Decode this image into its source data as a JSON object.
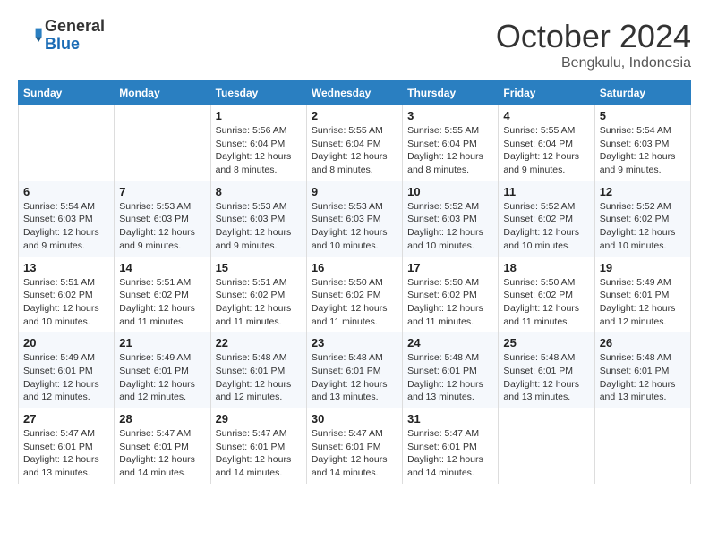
{
  "header": {
    "logo_general": "General",
    "logo_blue": "Blue",
    "month_year": "October 2024",
    "location": "Bengkulu, Indonesia"
  },
  "days_of_week": [
    "Sunday",
    "Monday",
    "Tuesday",
    "Wednesday",
    "Thursday",
    "Friday",
    "Saturday"
  ],
  "weeks": [
    [
      {
        "day": "",
        "sunrise": "",
        "sunset": "",
        "daylight": ""
      },
      {
        "day": "",
        "sunrise": "",
        "sunset": "",
        "daylight": ""
      },
      {
        "day": "1",
        "sunrise": "Sunrise: 5:56 AM",
        "sunset": "Sunset: 6:04 PM",
        "daylight": "Daylight: 12 hours and 8 minutes."
      },
      {
        "day": "2",
        "sunrise": "Sunrise: 5:55 AM",
        "sunset": "Sunset: 6:04 PM",
        "daylight": "Daylight: 12 hours and 8 minutes."
      },
      {
        "day": "3",
        "sunrise": "Sunrise: 5:55 AM",
        "sunset": "Sunset: 6:04 PM",
        "daylight": "Daylight: 12 hours and 8 minutes."
      },
      {
        "day": "4",
        "sunrise": "Sunrise: 5:55 AM",
        "sunset": "Sunset: 6:04 PM",
        "daylight": "Daylight: 12 hours and 9 minutes."
      },
      {
        "day": "5",
        "sunrise": "Sunrise: 5:54 AM",
        "sunset": "Sunset: 6:03 PM",
        "daylight": "Daylight: 12 hours and 9 minutes."
      }
    ],
    [
      {
        "day": "6",
        "sunrise": "Sunrise: 5:54 AM",
        "sunset": "Sunset: 6:03 PM",
        "daylight": "Daylight: 12 hours and 9 minutes."
      },
      {
        "day": "7",
        "sunrise": "Sunrise: 5:53 AM",
        "sunset": "Sunset: 6:03 PM",
        "daylight": "Daylight: 12 hours and 9 minutes."
      },
      {
        "day": "8",
        "sunrise": "Sunrise: 5:53 AM",
        "sunset": "Sunset: 6:03 PM",
        "daylight": "Daylight: 12 hours and 9 minutes."
      },
      {
        "day": "9",
        "sunrise": "Sunrise: 5:53 AM",
        "sunset": "Sunset: 6:03 PM",
        "daylight": "Daylight: 12 hours and 10 minutes."
      },
      {
        "day": "10",
        "sunrise": "Sunrise: 5:52 AM",
        "sunset": "Sunset: 6:03 PM",
        "daylight": "Daylight: 12 hours and 10 minutes."
      },
      {
        "day": "11",
        "sunrise": "Sunrise: 5:52 AM",
        "sunset": "Sunset: 6:02 PM",
        "daylight": "Daylight: 12 hours and 10 minutes."
      },
      {
        "day": "12",
        "sunrise": "Sunrise: 5:52 AM",
        "sunset": "Sunset: 6:02 PM",
        "daylight": "Daylight: 12 hours and 10 minutes."
      }
    ],
    [
      {
        "day": "13",
        "sunrise": "Sunrise: 5:51 AM",
        "sunset": "Sunset: 6:02 PM",
        "daylight": "Daylight: 12 hours and 10 minutes."
      },
      {
        "day": "14",
        "sunrise": "Sunrise: 5:51 AM",
        "sunset": "Sunset: 6:02 PM",
        "daylight": "Daylight: 12 hours and 11 minutes."
      },
      {
        "day": "15",
        "sunrise": "Sunrise: 5:51 AM",
        "sunset": "Sunset: 6:02 PM",
        "daylight": "Daylight: 12 hours and 11 minutes."
      },
      {
        "day": "16",
        "sunrise": "Sunrise: 5:50 AM",
        "sunset": "Sunset: 6:02 PM",
        "daylight": "Daylight: 12 hours and 11 minutes."
      },
      {
        "day": "17",
        "sunrise": "Sunrise: 5:50 AM",
        "sunset": "Sunset: 6:02 PM",
        "daylight": "Daylight: 12 hours and 11 minutes."
      },
      {
        "day": "18",
        "sunrise": "Sunrise: 5:50 AM",
        "sunset": "Sunset: 6:02 PM",
        "daylight": "Daylight: 12 hours and 11 minutes."
      },
      {
        "day": "19",
        "sunrise": "Sunrise: 5:49 AM",
        "sunset": "Sunset: 6:01 PM",
        "daylight": "Daylight: 12 hours and 12 minutes."
      }
    ],
    [
      {
        "day": "20",
        "sunrise": "Sunrise: 5:49 AM",
        "sunset": "Sunset: 6:01 PM",
        "daylight": "Daylight: 12 hours and 12 minutes."
      },
      {
        "day": "21",
        "sunrise": "Sunrise: 5:49 AM",
        "sunset": "Sunset: 6:01 PM",
        "daylight": "Daylight: 12 hours and 12 minutes."
      },
      {
        "day": "22",
        "sunrise": "Sunrise: 5:48 AM",
        "sunset": "Sunset: 6:01 PM",
        "daylight": "Daylight: 12 hours and 12 minutes."
      },
      {
        "day": "23",
        "sunrise": "Sunrise: 5:48 AM",
        "sunset": "Sunset: 6:01 PM",
        "daylight": "Daylight: 12 hours and 13 minutes."
      },
      {
        "day": "24",
        "sunrise": "Sunrise: 5:48 AM",
        "sunset": "Sunset: 6:01 PM",
        "daylight": "Daylight: 12 hours and 13 minutes."
      },
      {
        "day": "25",
        "sunrise": "Sunrise: 5:48 AM",
        "sunset": "Sunset: 6:01 PM",
        "daylight": "Daylight: 12 hours and 13 minutes."
      },
      {
        "day": "26",
        "sunrise": "Sunrise: 5:48 AM",
        "sunset": "Sunset: 6:01 PM",
        "daylight": "Daylight: 12 hours and 13 minutes."
      }
    ],
    [
      {
        "day": "27",
        "sunrise": "Sunrise: 5:47 AM",
        "sunset": "Sunset: 6:01 PM",
        "daylight": "Daylight: 12 hours and 13 minutes."
      },
      {
        "day": "28",
        "sunrise": "Sunrise: 5:47 AM",
        "sunset": "Sunset: 6:01 PM",
        "daylight": "Daylight: 12 hours and 14 minutes."
      },
      {
        "day": "29",
        "sunrise": "Sunrise: 5:47 AM",
        "sunset": "Sunset: 6:01 PM",
        "daylight": "Daylight: 12 hours and 14 minutes."
      },
      {
        "day": "30",
        "sunrise": "Sunrise: 5:47 AM",
        "sunset": "Sunset: 6:01 PM",
        "daylight": "Daylight: 12 hours and 14 minutes."
      },
      {
        "day": "31",
        "sunrise": "Sunrise: 5:47 AM",
        "sunset": "Sunset: 6:01 PM",
        "daylight": "Daylight: 12 hours and 14 minutes."
      },
      {
        "day": "",
        "sunrise": "",
        "sunset": "",
        "daylight": ""
      },
      {
        "day": "",
        "sunrise": "",
        "sunset": "",
        "daylight": ""
      }
    ]
  ]
}
